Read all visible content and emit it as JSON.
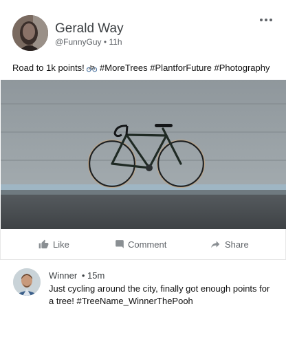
{
  "post": {
    "author_name": "Gerald Way",
    "handle": "@FunnyGuy",
    "separator": "•",
    "time": "11h",
    "text_prefix": "Road to 1k points!",
    "emoji": "🚲",
    "hashtags": [
      "#MoreTrees",
      "#PlantforFuture",
      "#Photography"
    ],
    "photo_subject": "bicycle leaning against concrete wall"
  },
  "actions": {
    "like_label": "Like",
    "comment_label": "Comment",
    "share_label": "Share"
  },
  "comment": {
    "author": "Winner",
    "separator": "•",
    "time": "15m",
    "text": "Just cycling around the city,  finally got enough points for a tree! #TreeName_WinnerThePooh"
  },
  "colors": {
    "text_primary": "#202124",
    "text_secondary": "#5f6368",
    "divider": "#e0e0e0"
  },
  "icons": [
    "more-horizontal-icon",
    "bicycle-emoji",
    "thumbs-up-icon",
    "comment-bubble-icon",
    "share-arrow-icon"
  ]
}
